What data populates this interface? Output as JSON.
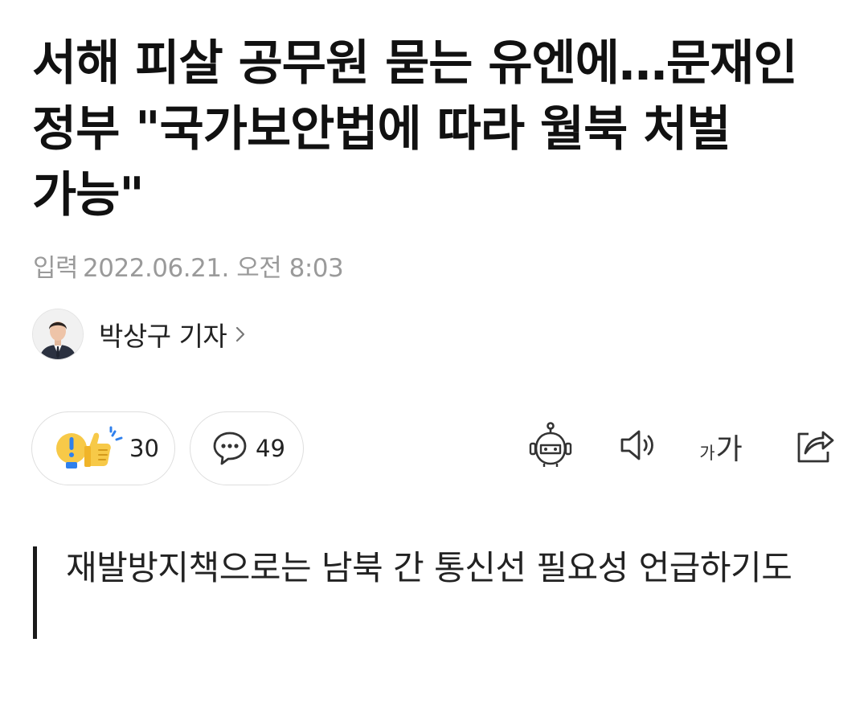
{
  "article": {
    "headline": "서해 피살 공무원 묻는 유엔에…문재인 정부 \"국가보안법에 따라 월북 처벌 가능\"",
    "date_label": "입력",
    "date_value": "2022.06.21. 오전 8:03",
    "reporter": {
      "name": "박상구 기자",
      "chevron_icon": "chevron-right-icon"
    },
    "subheading": "재발방지책으로는 남북 간 통신선 필요성 언급하기도"
  },
  "reactions": {
    "icons": [
      "surprise-emoji-icon",
      "thumbs-up-emoji-icon"
    ],
    "count": "30"
  },
  "comments": {
    "icon": "speech-bubble-icon",
    "count": "49"
  },
  "toolbar": {
    "items": [
      "robot-summary-icon",
      "speaker-icon",
      "font-size-icon",
      "share-icon"
    ],
    "font_small": "가",
    "font_big": "가"
  },
  "colors": {
    "text": "#111111",
    "muted": "#9a9a9a",
    "border": "#dedede",
    "emoji_yellow": "#f7c948",
    "emoji_blue": "#2f80ed"
  }
}
